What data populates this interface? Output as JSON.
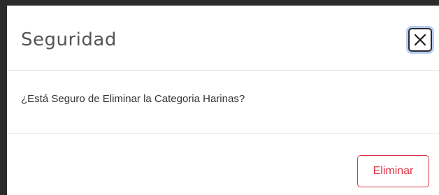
{
  "modal": {
    "title": "Seguridad",
    "close_icon": "close-icon",
    "message": "¿Está Seguro de Eliminar la Categoria Harinas?",
    "delete_label": "Eliminar"
  },
  "colors": {
    "danger": "#dc3545",
    "focus_ring": "#b9cdf2",
    "title_text": "#555555",
    "body_text": "#333333",
    "divider": "#e3e3e3"
  }
}
